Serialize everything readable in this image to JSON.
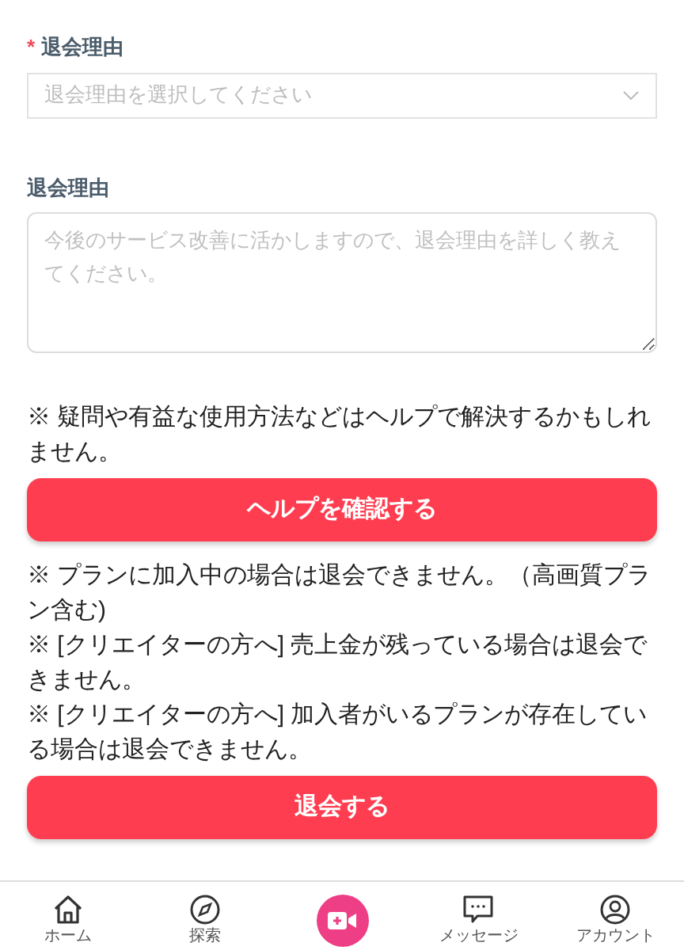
{
  "form": {
    "fields": [
      {
        "kind": "select",
        "required_mark": "*",
        "label": "退会理由",
        "placeholder": "退会理由を選択してください"
      },
      {
        "kind": "textarea",
        "label": "退会理由",
        "placeholder": "今後のサービス改善に活かしますので、退会理由を詳しく教えてください。"
      }
    ]
  },
  "help_note": "※ 疑問や有益な使用方法などはヘルプで解決するかもしれません。",
  "help_button": "ヘルプを確認する",
  "notes": [
    "※ プランに加入中の場合は退会できません。（高画質プラン含む)",
    "※ [クリエイターの方へ] 売上金が残っている場合は退会できません。",
    "※ [クリエイターの方へ] 加入者がいるプランが存在している場合は退会できません。"
  ],
  "withdraw_button": "退会する",
  "bottom_nav": [
    {
      "kind": "home",
      "label": "ホーム"
    },
    {
      "kind": "explore",
      "label": "探索"
    },
    {
      "kind": "record"
    },
    {
      "kind": "messages",
      "label": "メッセージ"
    },
    {
      "kind": "account",
      "label": "アカウント"
    }
  ]
}
